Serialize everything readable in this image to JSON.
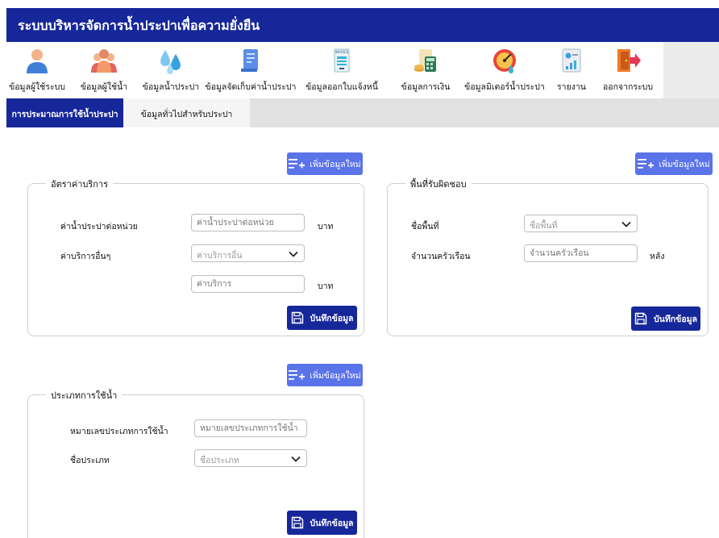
{
  "app": {
    "title": "ระบบบริหารจัดการน้ำประปาเพื่อความยั่งยืน"
  },
  "menu": [
    {
      "label": "ข้อมูลผู้ใช้ระบบ",
      "icon": "user-icon"
    },
    {
      "label": "ข้อมูลผู้ใช้น้ำ",
      "icon": "users-group-icon"
    },
    {
      "label": "ข้อมูลน้ำประปา",
      "icon": "water-drops-icon"
    },
    {
      "label": "ข้อมูลจัดเก็บค่าน้ำประปา",
      "icon": "document-icon"
    },
    {
      "label": "ข้อมูลออกใบแจ้งหนี้",
      "icon": "invoice-icon",
      "badge": "INVOICE"
    },
    {
      "label": "ข้อมูลการเงิน",
      "icon": "finance-icon"
    },
    {
      "label": "ข้อมูลมิเตอร์น้ำประปา",
      "icon": "meter-icon"
    },
    {
      "label": "รายงาน",
      "icon": "report-icon"
    },
    {
      "label": "ออกจากระบบ",
      "icon": "logout-icon"
    }
  ],
  "tabs": [
    {
      "label": "การประมาณการใช้น้ำประปา",
      "active": true
    },
    {
      "label": "ข้อมูลทั่วไปสำหรับประปา",
      "active": false
    }
  ],
  "common": {
    "add_label": "เพิ่มข้อมูลใหม่",
    "save_label": "บันทึกข้อมูล"
  },
  "rates_panel": {
    "legend": "อัตราค่าบริการ",
    "water_rate_label": "ค่าน้ำประปาต่อหน่วย",
    "water_rate_placeholder": "ค่าน้ำประปาต่อหน่วย",
    "water_rate_unit": "บาท",
    "other_services_label": "ค่าบริการอื่นๆ",
    "other_services_select": "ค่าบริการอื่น",
    "service_fee_placeholder": "ค่าบริการ",
    "service_fee_unit": "บาท"
  },
  "area_panel": {
    "legend": "พื้นที่รับผิดชอบ",
    "area_name_label": "ชื่อพื้นที่",
    "area_name_select": "ชื่อพื้นที่",
    "households_label": "จำนวนครัวเรือน",
    "households_placeholder": "จำนวนครัวเรือน",
    "households_unit": "หลัง"
  },
  "usage_panel": {
    "legend": "ประเภทการใช้น้ำ",
    "type_no_label": "หมายเลขประเภทการใช้น้ำ",
    "type_no_placeholder": "หมายเลขประเภทการใช้น้ำ",
    "type_name_label": "ชื่อประเภท",
    "type_name_select": "ชื่อประเภท"
  },
  "colors": {
    "primary": "#16279a",
    "add_button": "#5b73e8",
    "tab_bg": "#e1e1e1"
  }
}
